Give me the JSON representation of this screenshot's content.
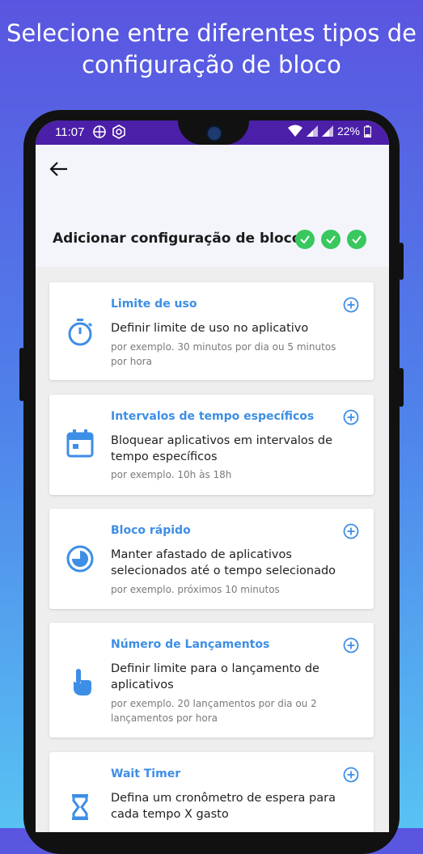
{
  "headline": {
    "line1": "Selecione entre diferentes tipos de",
    "line2": "configuração de bloco"
  },
  "status_bar": {
    "time": "11:07",
    "battery": "22%",
    "icons": [
      "vpn-icon",
      "shield-app-icon",
      "wifi-icon",
      "signal-icon",
      "signal-icon",
      "battery-icon"
    ]
  },
  "header": {
    "title": "Adicionar configuração de bloco",
    "progress_steps_completed": 3,
    "colors": {
      "check": "#38c85e",
      "accent": "#3d8ee6",
      "status_bar": "#4b1fa8"
    }
  },
  "cards": [
    {
      "title": "Limite de uso",
      "description": "Definir limite de uso no aplicativo",
      "example_line1": "por exemplo. 30 minutos por dia ou 5 minutos",
      "example_line2": "por hora",
      "icon": "stopwatch-icon"
    },
    {
      "title": "Intervalos de tempo específicos",
      "description_line1": "Bloquear aplicativos em intervalos de",
      "description_line2": "tempo específicos",
      "example_line1": "por exemplo. 10h às 18h",
      "icon": "calendar-icon"
    },
    {
      "title": "Bloco rápido",
      "description_line1": "Manter afastado de aplicativos",
      "description_line2": "selecionados até o tempo selecionado",
      "example_line1": "por exemplo. próximos 10 minutos",
      "icon": "timer-dial-icon"
    },
    {
      "title": "Número de Lançamentos",
      "description_line1": "Definir limite para o lançamento de",
      "description_line2": "aplicativos",
      "example_line1": "por exemplo. 20 lançamentos por dia ou 2",
      "example_line2": "lançamentos por hora",
      "icon": "tap-hand-icon"
    },
    {
      "title": "Wait Timer",
      "description_line1": "Defina um cronômetro de espera para",
      "description_line2": "cada tempo X gasto",
      "icon": "hourglass-icon"
    }
  ]
}
